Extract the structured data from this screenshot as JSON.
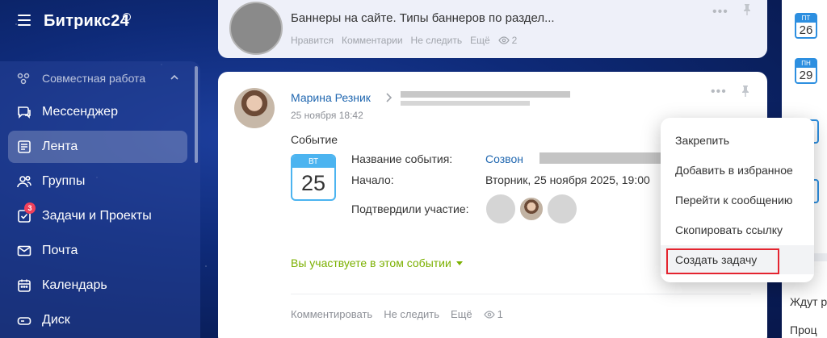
{
  "app": {
    "name": "Битрикс24"
  },
  "sidebar": {
    "group_label": "Совместная работа",
    "items": [
      {
        "label": "Мессенджер",
        "icon": "chat-icon"
      },
      {
        "label": "Лента",
        "icon": "feed-icon",
        "active": true
      },
      {
        "label": "Группы",
        "icon": "groups-icon"
      },
      {
        "label": "Задачи и Проекты",
        "icon": "tasks-icon",
        "badge": "3"
      },
      {
        "label": "Почта",
        "icon": "mail-icon"
      },
      {
        "label": "Календарь",
        "icon": "calendar-icon"
      },
      {
        "label": "Диск",
        "icon": "disk-icon"
      }
    ]
  },
  "feed": {
    "top_post": {
      "title": "Баннеры на сайте. Типы баннеров по раздел...",
      "actions": [
        "Нравится",
        "Комментарии",
        "Не следить",
        "Ещё"
      ],
      "views": "2"
    },
    "event_post": {
      "author": "Марина Резник",
      "date": "25 ноября 18:42",
      "section_title": "Событие",
      "calendar": {
        "dow": "ВТ",
        "day": "25"
      },
      "fields": {
        "name_label": "Название события:",
        "name_value": "Созвон",
        "start_label": "Начало:",
        "start_value": "Вторник, 25 ноября 2025, 19:00",
        "confirmed_label": "Подтвердили участие:"
      },
      "participating_label": "Вы участвуете в этом событии",
      "actions": [
        "Комментировать",
        "Не следить",
        "Ещё"
      ],
      "views": "1"
    }
  },
  "context_menu": {
    "items": [
      "Закрепить",
      "Добавить в избранное",
      "Перейти к сообщению",
      "Скопировать ссылку",
      "Создать задачу"
    ],
    "highlight_color": "#e4242f"
  },
  "right_column": {
    "calendars": [
      {
        "dow": "ПТ",
        "day": "26"
      },
      {
        "dow": "ПН",
        "day": "29"
      }
    ],
    "texts": [
      "Ждут р",
      "Проц"
    ]
  },
  "colors": {
    "accent_link": "#2067b0",
    "participating_green": "#7bb000",
    "calendar_blue": "#4cb4f0",
    "badge_red": "#f0405b"
  }
}
